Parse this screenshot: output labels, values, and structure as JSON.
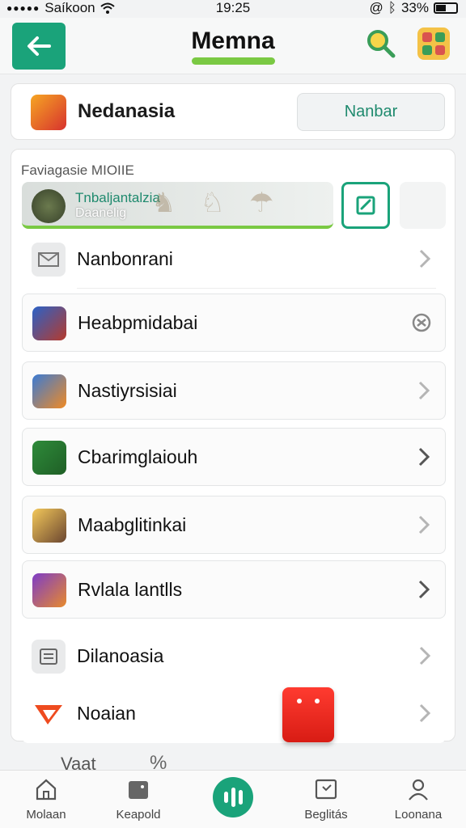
{
  "status_bar": {
    "carrier": "Saíkoon",
    "time": "19:25",
    "battery": "33%"
  },
  "header": {
    "title": "Memna"
  },
  "profile": {
    "name": "Nedanasia",
    "button_label": "Nanbar"
  },
  "section": {
    "label": "Faviagasie MIOIIE"
  },
  "featured": {
    "title": "Tnbaljantalzia",
    "subtitle": "Daanelig"
  },
  "rows": [
    {
      "label": "Nanbonrani",
      "icon": "mail-icon",
      "chevron": "chevron-right-icon"
    },
    {
      "label": "Heabpmidabai",
      "icon": "game-icon",
      "chevron": "settings-gear-icon"
    },
    {
      "label": "Nastiyrsisiai",
      "icon": "character-icon",
      "chevron": "chevron-right-icon"
    },
    {
      "label": "Cbarimglaiouh",
      "icon": "weapon-icon",
      "chevron": "chevron-right-icon"
    },
    {
      "label": "Maabglitinkai",
      "icon": "creature-icon",
      "chevron": "chevron-right-icon"
    },
    {
      "label": "Rvlala lantlls",
      "icon": "tool-icon",
      "chevron": "chevron-right-icon"
    },
    {
      "label": "Dilanoasia",
      "icon": "calculator-icon",
      "chevron": "chevron-right-icon"
    },
    {
      "label": "Noaian",
      "icon": "play-icon",
      "chevron": "chevron-right-icon"
    }
  ],
  "peek": {
    "text": "Vaat",
    "symbol": "%"
  },
  "bottom_nav": [
    {
      "label": "Molaan",
      "icon": "home-icon"
    },
    {
      "label": "Keapold",
      "icon": "bag-icon"
    },
    {
      "label": "",
      "icon": "audio-bars-icon"
    },
    {
      "label": "Beglitás",
      "icon": "calendar-icon"
    },
    {
      "label": "Loonana",
      "icon": "user-icon"
    }
  ],
  "colors": {
    "accent": "#1aa37a",
    "highlight": "#7ac943",
    "alert": "#e6261c"
  }
}
